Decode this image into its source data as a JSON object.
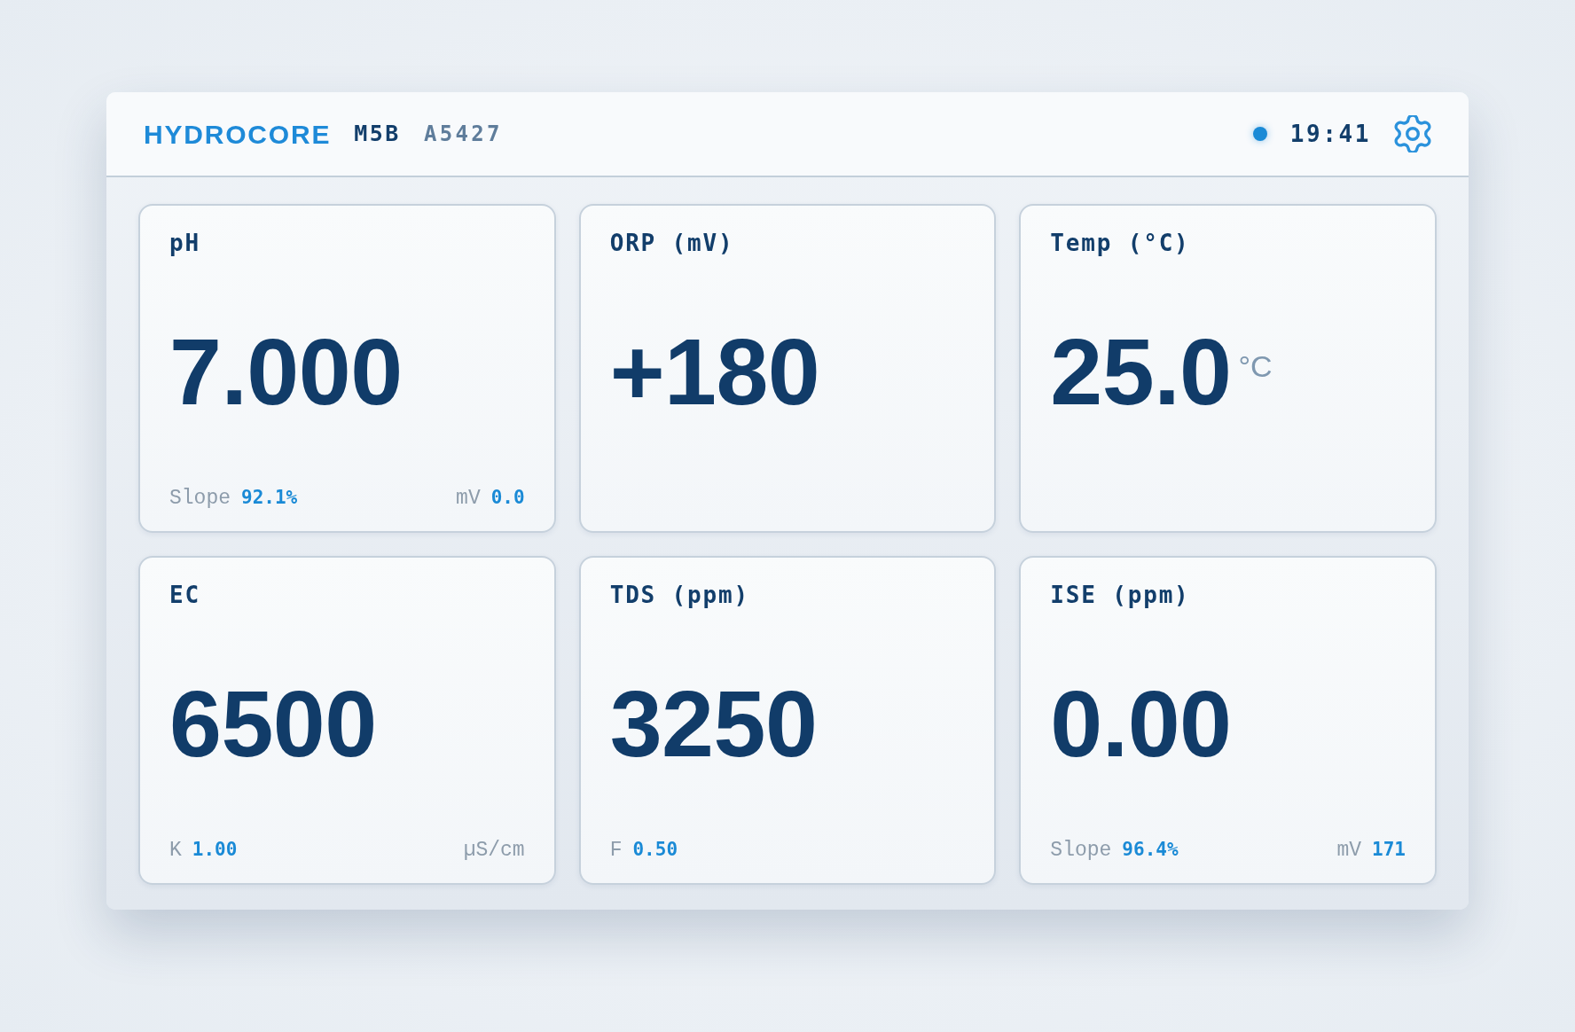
{
  "header": {
    "brand": "HYDROCORE",
    "model": "M5B",
    "serial": "A5427",
    "time": "19:41"
  },
  "cards": [
    {
      "label": "pH",
      "value": "7.000",
      "footer": [
        {
          "label": "Slope",
          "value": "92.1%"
        },
        {
          "label": "mV",
          "value": "0.0"
        }
      ]
    },
    {
      "label": "ORP (mV)",
      "value": "+180"
    },
    {
      "label": "Temp (°C)",
      "value": "25.0",
      "unit": "°C"
    },
    {
      "label": "EC",
      "value": "6500",
      "footer": [
        {
          "label": "K",
          "value": "1.00"
        },
        {
          "label": "µS/cm"
        }
      ]
    },
    {
      "label": "TDS (ppm)",
      "value": "3250",
      "footer": [
        {
          "label": "F",
          "value": "0.50"
        }
      ]
    },
    {
      "label": "ISE (ppm)",
      "value": "0.00",
      "footer": [
        {
          "label": "Slope",
          "value": "96.4%"
        },
        {
          "label": "mV",
          "value": "171"
        }
      ]
    }
  ]
}
